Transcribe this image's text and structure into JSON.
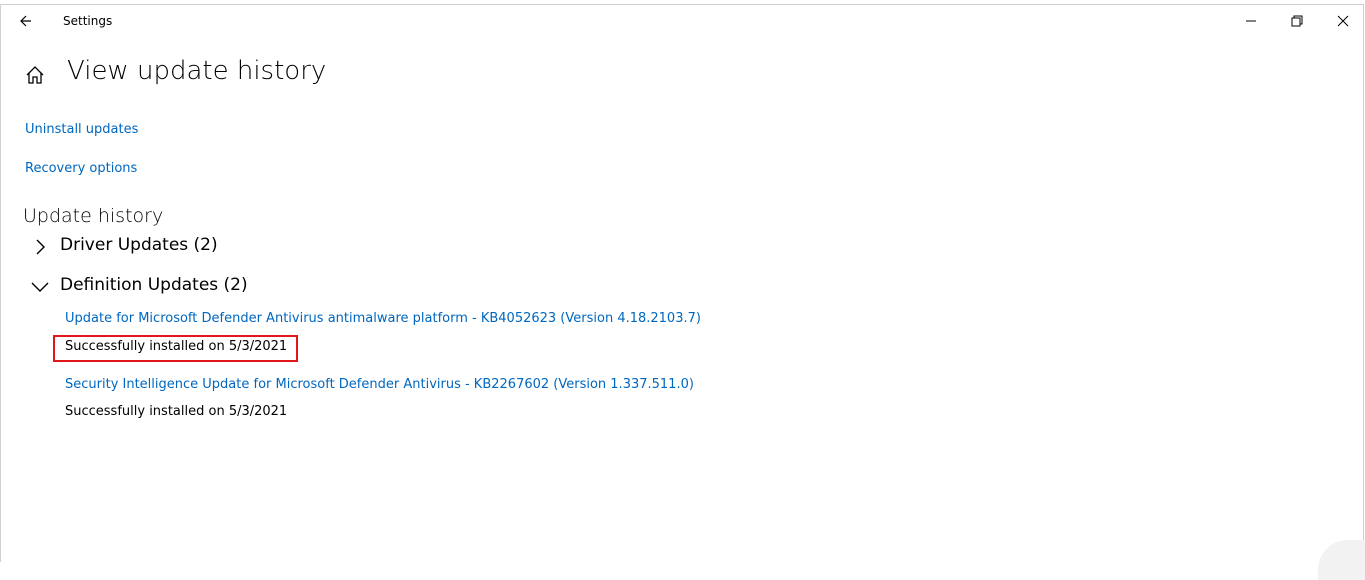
{
  "window": {
    "app_title": "Settings",
    "controls": {
      "minimize": "minimize-icon",
      "restore": "restore-icon",
      "close": "close-icon"
    }
  },
  "header": {
    "home_icon": "home-icon",
    "title": "View update history"
  },
  "links": {
    "uninstall": "Uninstall updates",
    "recovery": "Recovery options"
  },
  "history": {
    "title": "Update history",
    "groups": [
      {
        "label": "Driver Updates (2)",
        "expanded": false
      },
      {
        "label": "Definition Updates (2)",
        "expanded": true,
        "items": [
          {
            "name": "Update for Microsoft Defender Antivirus antimalware platform - KB4052623 (Version 4.18.2103.7)",
            "status": "Successfully installed on 5/3/2021",
            "highlighted": true
          },
          {
            "name": "Security Intelligence Update for Microsoft Defender Antivirus - KB2267602 (Version 1.337.511.0)",
            "status": "Successfully installed on 5/3/2021",
            "highlighted": false
          }
        ]
      }
    ]
  },
  "colors": {
    "link": "#0067c0",
    "highlight_border": "#e0161b",
    "text": "#000000",
    "background": "#ffffff"
  }
}
